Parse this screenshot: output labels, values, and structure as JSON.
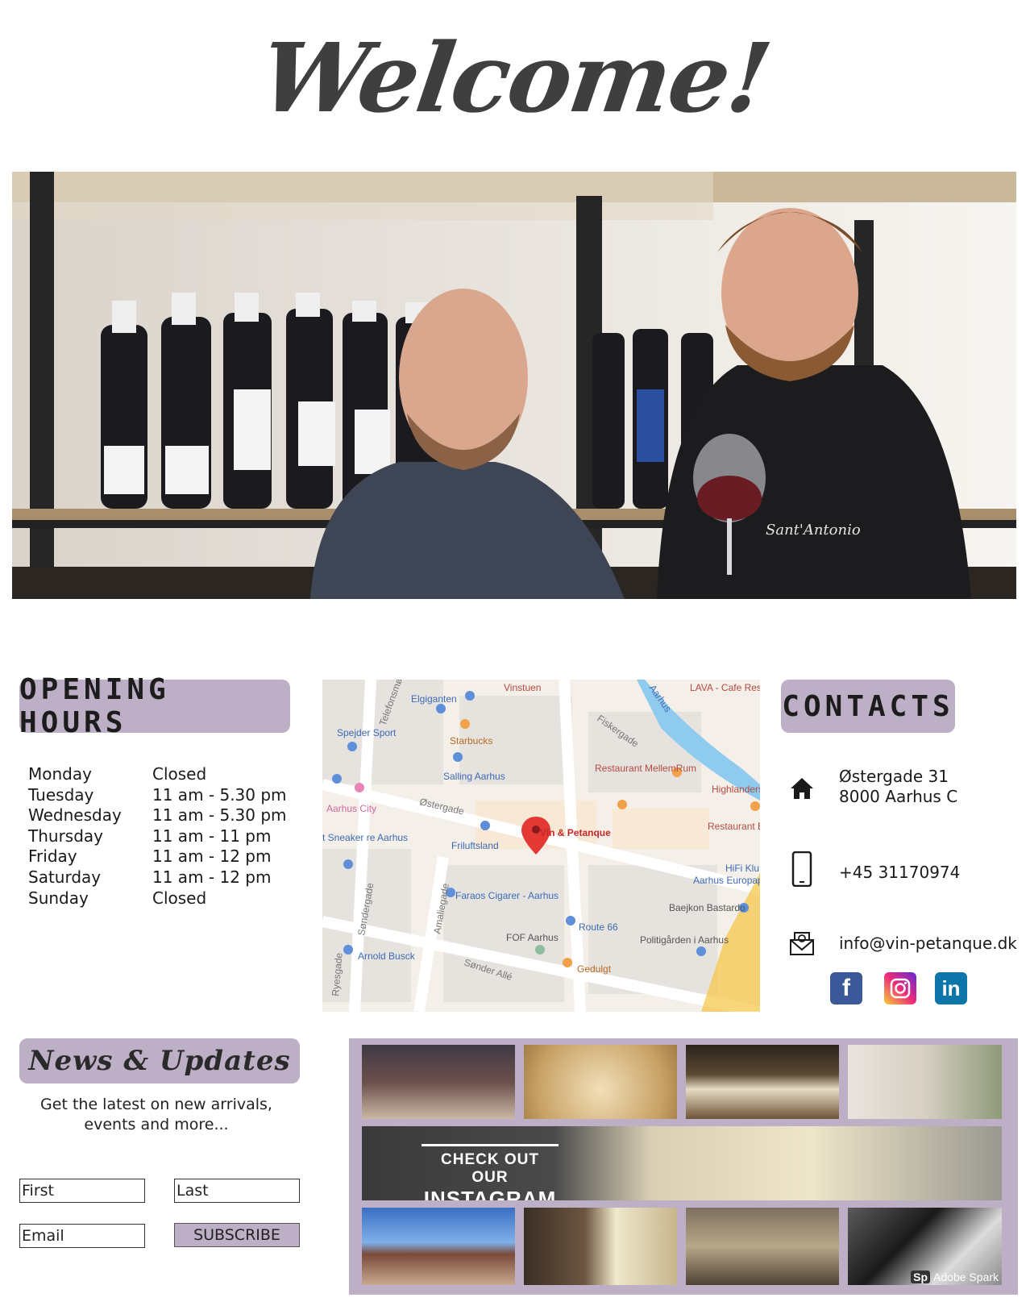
{
  "header": {
    "title": "Welcome!"
  },
  "opening_hours": {
    "title": "OPENING HOURS",
    "rows": [
      {
        "day": "Monday",
        "time": "Closed"
      },
      {
        "day": "Tuesday",
        "time": "11 am - 5.30 pm"
      },
      {
        "day": "Wednesday",
        "time": "11 am - 5.30 pm"
      },
      {
        "day": "Thursday",
        "time": "11 am - 11 pm"
      },
      {
        "day": "Friday",
        "time": "11 am - 12 pm"
      },
      {
        "day": "Saturday",
        "time": "11 am - 12 pm"
      },
      {
        "day": "Sunday",
        "time": "Closed"
      }
    ]
  },
  "map": {
    "pin_label": "Vin & Petanque",
    "places": [
      "Elgiganten",
      "Vinstuen",
      "Starbucks",
      "Spejder Sport",
      "Salling Aarhus",
      "Restaurant MellemRum",
      "Aarhus City",
      "Friluftsland",
      "Faraos Cigarer - Aarhus",
      "Route 66",
      "FOF Aarhus",
      "Arnold Busck",
      "Gedulgt",
      "Baejkon Bastardo",
      "Politigården i Aarhus",
      "Highlanders",
      "Restaurant E",
      "HiFi Klu",
      "Aarhus Europap",
      "t Sneaker re Aarhus",
      "LAVA - Cafe Restaurant, I"
    ],
    "streets": [
      "Østergade",
      "Sønder Allé",
      "Fiskergade",
      "Amaliegade",
      "Søndergade",
      "Ryesgade",
      "Telefonsmøgen",
      "Aarhus"
    ]
  },
  "contacts": {
    "title": "CONTACTS",
    "address_line1": "Østergade 31",
    "address_line2": "8000 Aarhus C",
    "phone": "+45 31170974",
    "email": "info@vin-petanque.dk",
    "icons": [
      "home-icon",
      "phone-icon",
      "email-icon"
    ],
    "social": [
      "facebook-icon",
      "instagram-icon",
      "linkedin-icon"
    ]
  },
  "news": {
    "title": "News & Updates",
    "subtitle_line1": "Get the latest on new arrivals,",
    "subtitle_line2": "events and more...",
    "first_placeholder": "First",
    "last_placeholder": "Last",
    "email_placeholder": "Email",
    "subscribe_label": "SUBSCRIBE"
  },
  "instagram": {
    "banner_line1": "CHECK OUT OUR",
    "banner_line2": "INSTAGRAM",
    "badge_sp": "Sp",
    "badge_label": "Adobe Spark"
  },
  "colors": {
    "accent": "#bdafc6",
    "heading": "#3f3f3f",
    "pin": "#e53935"
  }
}
